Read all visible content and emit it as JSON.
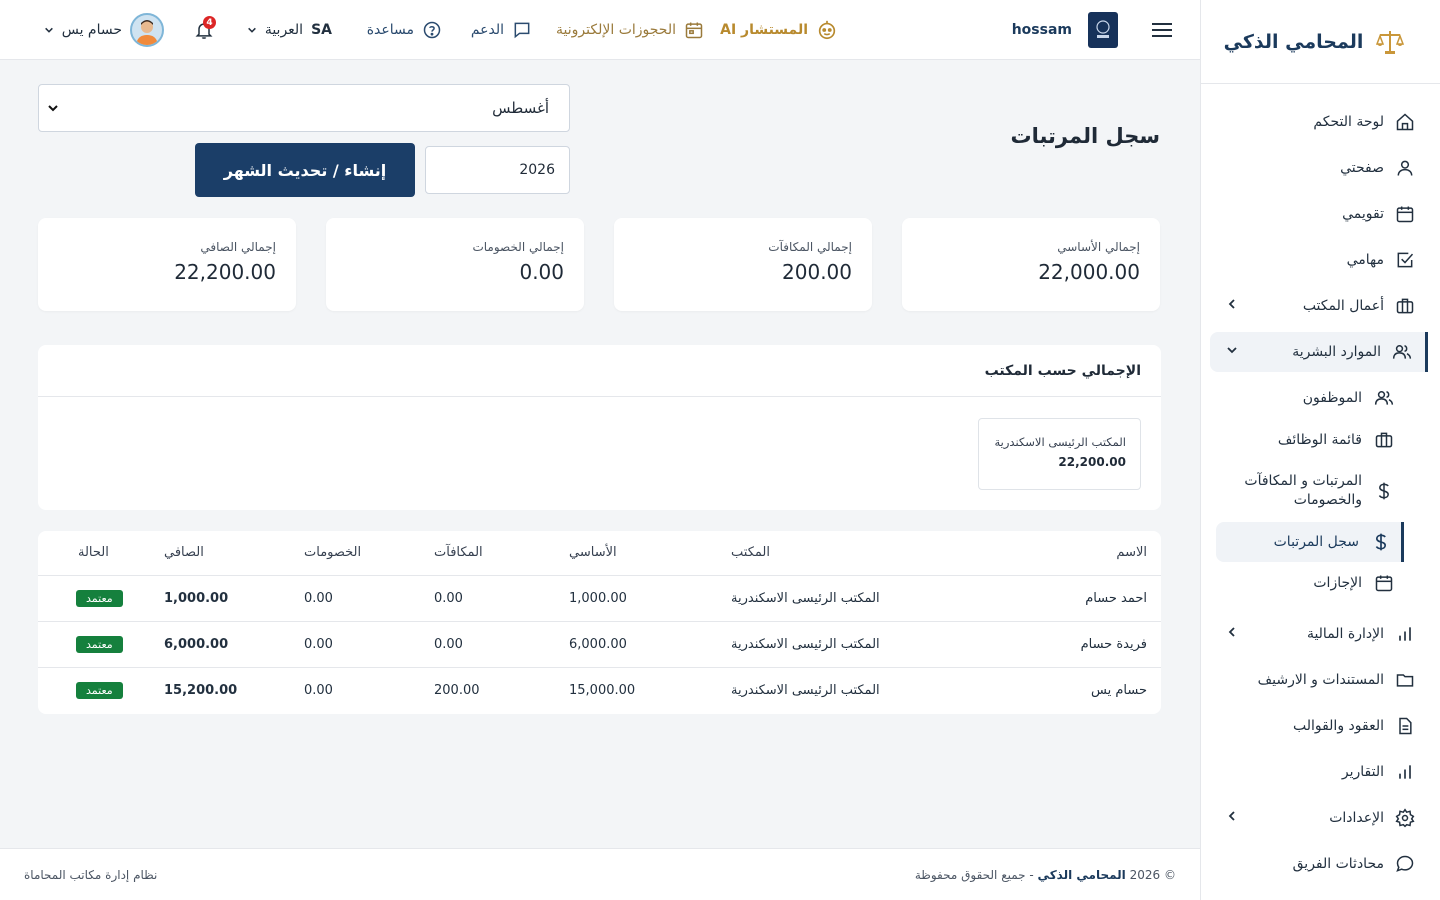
{
  "sidebar": {
    "brand": "المحامي الذكي",
    "items": [
      {
        "label": "لوحة التحكم"
      },
      {
        "label": "صفحتي"
      },
      {
        "label": "تقويمي"
      },
      {
        "label": "مهامي"
      },
      {
        "label": "أعمال المكتب"
      },
      {
        "label": "الموارد البشرية"
      },
      {
        "label": "الإدارة المالية"
      },
      {
        "label": "المستندات و الارشيف"
      },
      {
        "label": "العقود والقوالب"
      },
      {
        "label": "التقارير"
      },
      {
        "label": "الإعدادات"
      },
      {
        "label": "محادثات الفريق"
      }
    ],
    "hr_sub": [
      {
        "label": "الموظفون"
      },
      {
        "label": "قائمة الوظائف"
      },
      {
        "label": "المرتبات و المكافآت والخصومات"
      },
      {
        "label": "سجل المرتبات"
      },
      {
        "label": "الإجازات"
      }
    ]
  },
  "topbar": {
    "username_short": "hossam",
    "advisor": "المستشار AI",
    "bookings": "الحجوزات الإلكترونية",
    "support": "الدعم",
    "help": "مساعدة",
    "lang_label": "العربية",
    "lang_code": "SA",
    "notifications_count": "4",
    "user_name": "حسام يس"
  },
  "page": {
    "title": "سجل المرتبات",
    "month_selected": "أغسطس",
    "year_value": "2026",
    "generate_button": "إنشاء / تحديث الشهر"
  },
  "stats": [
    {
      "label": "إجمالي الأساسي",
      "value": "22,000.00"
    },
    {
      "label": "إجمالي المكافآت",
      "value": "200.00"
    },
    {
      "label": "إجمالي الخصومات",
      "value": "0.00"
    },
    {
      "label": "إجمالي الصافي",
      "value": "22,200.00"
    }
  ],
  "by_office": {
    "title": "الإجمالي حسب المكتب",
    "cards": [
      {
        "office": "المكتب الرئيسى الاسكندرية",
        "total": "22,200.00"
      }
    ]
  },
  "table": {
    "headers": {
      "name": "الاسم",
      "office": "المكتب",
      "basic": "الأساسي",
      "bonuses": "المكافآت",
      "deductions": "الخصومات",
      "net": "الصافي",
      "status": "الحالة"
    },
    "rows": [
      {
        "name": "احمد حسام",
        "office": "المكتب الرئيسى الاسكندرية",
        "basic": "1,000.00",
        "bonuses": "0.00",
        "deductions": "0.00",
        "net": "1,000.00",
        "status": "معتمد"
      },
      {
        "name": "فريدة حسام",
        "office": "المكتب الرئيسى الاسكندرية",
        "basic": "6,000.00",
        "bonuses": "0.00",
        "deductions": "0.00",
        "net": "6,000.00",
        "status": "معتمد"
      },
      {
        "name": "حسام يس",
        "office": "المكتب الرئيسى الاسكندرية",
        "basic": "15,000.00",
        "bonuses": "200.00",
        "deductions": "0.00",
        "net": "15,200.00",
        "status": "معتمد"
      }
    ]
  },
  "footer": {
    "copyright_prefix": "© 2026",
    "brand": "المحامي الذكي",
    "rights": "- جميع الحقوق محفوظة",
    "system": "نظام إدارة مكاتب المحاماة"
  },
  "colors": {
    "primary": "#1b3e68",
    "accent_gold": "#b88a2e",
    "success": "#15803d",
    "danger": "#dc2626",
    "background": "#f3f5f7"
  }
}
